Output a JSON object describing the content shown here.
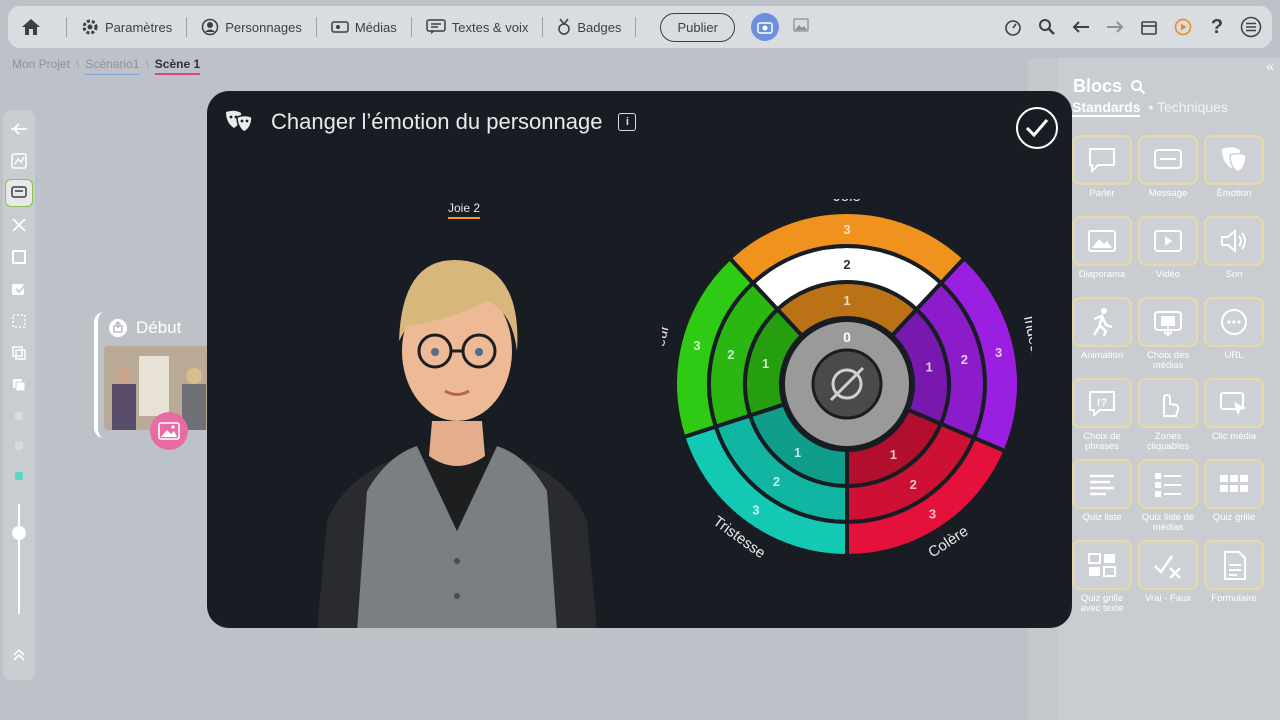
{
  "toolbar": {
    "items": [
      {
        "label": "Paramètres",
        "icon": "gear-icon"
      },
      {
        "label": "Personnages",
        "icon": "person-icon"
      },
      {
        "label": "Médias",
        "icon": "media-icon"
      },
      {
        "label": "Textes & voix",
        "icon": "text-voice-icon"
      },
      {
        "label": "Badges",
        "icon": "badge-icon"
      }
    ],
    "publish_label": "Publier",
    "right_icons": [
      "timer-icon",
      "search-icon",
      "arrow-left-icon",
      "arrow-right-icon",
      "calendar-icon",
      "play-icon",
      "help-icon",
      "menu-icon"
    ]
  },
  "breadcrumb": {
    "project": "Mon Projet",
    "scenario": "Scénario1",
    "scene": "Scène 1",
    "separator": "\\"
  },
  "scene_card": {
    "title": "Début"
  },
  "modal": {
    "title": "Changer l’émotion du personnage",
    "selected_emotion": "Joie 2"
  },
  "wheel": {
    "center_value": "0",
    "emotions": [
      {
        "name": "Joie",
        "color": "#f0921e",
        "levels": [
          "1",
          "2",
          "3"
        ]
      },
      {
        "name": "Indécision",
        "color": "#9b1fe0",
        "levels": [
          "1",
          "2",
          "3"
        ]
      },
      {
        "name": "Colère",
        "color": "#e4123a",
        "levels": [
          "1",
          "2",
          "3"
        ]
      },
      {
        "name": "Tristesse",
        "color": "#14c9b4",
        "levels": [
          "1",
          "2",
          "3"
        ]
      },
      {
        "name": "Peur",
        "color": "#2fcb14",
        "levels": [
          "1",
          "2",
          "3"
        ]
      }
    ]
  },
  "panel": {
    "title": "Blocs",
    "tabs": {
      "standard": "Standards",
      "technical": "Techniques"
    },
    "blocks": [
      {
        "label": "Parler",
        "icon": "speech-bubble-icon"
      },
      {
        "label": "Message",
        "icon": "message-icon"
      },
      {
        "label": "Émotion",
        "icon": "theater-masks-icon"
      },
      {
        "label": "Diaporama",
        "icon": "slideshow-icon"
      },
      {
        "label": "Vidéo",
        "icon": "video-icon"
      },
      {
        "label": "Son",
        "icon": "speaker-icon"
      },
      {
        "label": "Animation",
        "icon": "running-man-icon"
      },
      {
        "label": "Choix des médias",
        "icon": "media-choice-icon"
      },
      {
        "label": "URL",
        "icon": "url-icon"
      },
      {
        "label": "Choix de phrases",
        "icon": "phrase-choice-icon"
      },
      {
        "label": "Zones cliquables",
        "icon": "touch-icon"
      },
      {
        "label": "Clic média",
        "icon": "click-media-icon"
      },
      {
        "label": "Quiz liste",
        "icon": "list-icon"
      },
      {
        "label": "Quiz liste de médias",
        "icon": "media-list-icon"
      },
      {
        "label": "Quiz grille",
        "icon": "grid-icon"
      },
      {
        "label": "Quiz grille avec texte",
        "icon": "grid-text-icon"
      },
      {
        "label": "Vrai - Faux",
        "icon": "true-false-icon"
      },
      {
        "label": "Formulaire",
        "icon": "form-icon"
      }
    ]
  }
}
